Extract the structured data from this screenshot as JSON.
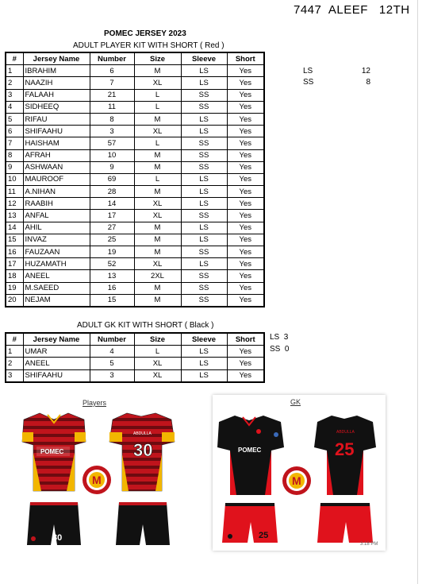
{
  "header": {
    "text": "7447  ALEEF   12TH"
  },
  "doc_title": "POMEC JERSEY 2023",
  "players_table": {
    "caption": "ADULT PLAYER KIT WITH SHORT ( Red )",
    "columns": [
      "#",
      "Jersey Name",
      "Number",
      "Size",
      "Sleeve",
      "Short"
    ],
    "rows": [
      [
        "1",
        "IBRAHIM",
        "6",
        "M",
        "LS",
        "Yes"
      ],
      [
        "2",
        "NAAZIH",
        "7",
        "XL",
        "LS",
        "Yes"
      ],
      [
        "3",
        "FALAAH",
        "21",
        "L",
        "SS",
        "Yes"
      ],
      [
        "4",
        "SIDHEEQ",
        "11",
        "L",
        "SS",
        "Yes"
      ],
      [
        "5",
        " RIFAU",
        "8",
        "M",
        "LS",
        "Yes"
      ],
      [
        "6",
        "SHIFAAHU",
        "3",
        "XL",
        "LS",
        "Yes"
      ],
      [
        "7",
        "HAISHAM",
        "57",
        "L",
        "SS",
        "Yes"
      ],
      [
        "8",
        "AFRAH",
        "10",
        "M",
        "SS",
        "Yes"
      ],
      [
        "9",
        "ASHWAAN",
        "9",
        "M",
        "SS",
        "Yes"
      ],
      [
        "10",
        "MAUROOF",
        "69",
        "L",
        "LS",
        "Yes"
      ],
      [
        "11",
        "A.NIHAN",
        "28",
        "M",
        "LS",
        "Yes"
      ],
      [
        "12",
        "RAABIH",
        "14",
        "XL",
        "LS",
        "Yes"
      ],
      [
        "13",
        "ANFAL",
        "17",
        "XL",
        "SS",
        "Yes"
      ],
      [
        "14",
        "AHIL",
        "27",
        "M",
        "LS",
        "Yes"
      ],
      [
        "15",
        "INVAZ",
        "25",
        "M",
        "LS",
        "Yes"
      ],
      [
        "16",
        "FAUZAAN",
        "19",
        "M",
        "SS",
        "Yes"
      ],
      [
        "17",
        "HUZAMATH",
        "52",
        "XL",
        "LS",
        "Yes"
      ],
      [
        "18",
        "ANEEL",
        "13",
        "2XL",
        "SS",
        "Yes"
      ],
      [
        "19",
        "M.SAEED",
        "16",
        "M",
        "SS",
        "Yes"
      ],
      [
        "20",
        "NEJAM",
        "15",
        "M",
        "SS",
        "Yes"
      ]
    ]
  },
  "players_summary": [
    {
      "label": "LS",
      "count": "12"
    },
    {
      "label": "SS",
      "count": "8"
    }
  ],
  "gk_table": {
    "caption": "ADULT GK KIT WITH SHORT ( Black )",
    "columns": [
      "#",
      "Jersey Name",
      "Number",
      "Size",
      "Sleeve",
      "Short"
    ],
    "rows": [
      [
        "1",
        "UMAR",
        "4",
        "L",
        "LS",
        "Yes"
      ],
      [
        "2",
        "ANEEL",
        "5",
        "XL",
        "LS",
        "Yes"
      ],
      [
        "3",
        "SHIFAAHU",
        "3",
        "XL",
        "LS",
        "Yes"
      ]
    ]
  },
  "gk_summary": [
    {
      "label": "LS",
      "count": "3"
    },
    {
      "label": "SS",
      "count": "0"
    }
  ],
  "images": {
    "players": {
      "label": "Players",
      "front_brand": "POMEC",
      "back_name": "ABDULLA",
      "back_number": "30",
      "short_number": "30",
      "colors": {
        "red": "#c0141c",
        "dark_red": "#6e0b10",
        "yellow": "#f2b600",
        "black": "#111111"
      }
    },
    "gk": {
      "label": "GK",
      "front_brand": "POMEC",
      "back_name": "ABDULLA",
      "back_number": "25",
      "short_number": "25",
      "timestamp": "3:18 PM",
      "colors": {
        "black": "#111111",
        "red": "#e0121c",
        "white": "#ffffff"
      }
    }
  }
}
